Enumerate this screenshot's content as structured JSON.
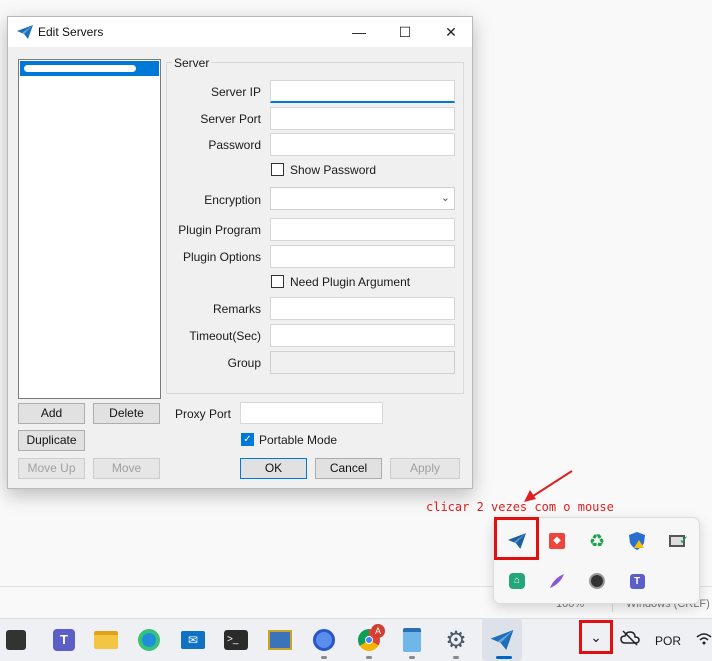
{
  "window": {
    "title": "Edit Servers",
    "minimize_glyph": "—",
    "maximize_glyph": "☐",
    "close_glyph": "✕"
  },
  "server_list": {
    "items": [
      {
        "label": "",
        "selected": true
      }
    ]
  },
  "server_group": {
    "title": "Server",
    "server_ip_label": "Server IP",
    "server_port_label": "Server Port",
    "password_label": "Password",
    "show_password_label": "Show Password",
    "encryption_label": "Encryption",
    "plugin_program_label": "Plugin Program",
    "plugin_options_label": "Plugin Options",
    "need_plugin_argument_label": "Need Plugin Argument",
    "remarks_label": "Remarks",
    "timeout_label": "Timeout(Sec)",
    "group_label": "Group",
    "show_password_checked": false,
    "need_plugin_argument_checked": false
  },
  "buttons": {
    "add": "Add",
    "delete": "Delete",
    "duplicate": "Duplicate",
    "move_up": "Move Up",
    "move": "Move",
    "ok": "OK",
    "cancel": "Cancel",
    "apply": "Apply"
  },
  "proxy": {
    "proxy_port_label": "Proxy Port",
    "portable_mode_label": "Portable Mode",
    "portable_mode_checked": true
  },
  "annotation": {
    "text": "clicar 2 vezes com o mouse",
    "color": "#e02020"
  },
  "background_status": {
    "zoom": "100%",
    "line_ending": "Windows (CRLF)"
  },
  "tray_popup": {
    "icons": [
      "shadowsocks-icon",
      "anydesk-icon",
      "recycle-icon",
      "defender-shield-icon",
      "network-check-icon",
      "green-app-icon",
      "feather-icon",
      "clock-icon",
      "teams-tray-icon"
    ]
  },
  "taskbar": {
    "language": "POR",
    "apps": [
      "start-icon",
      "teams-icon",
      "file-explorer-icon",
      "edge-icon",
      "mail-icon",
      "terminal-icon",
      "network-icon",
      "app-hub-icon",
      "chrome-icon",
      "notepad-icon",
      "settings-icon",
      "shadowsocks-taskbar-icon"
    ],
    "chrome_badge": "A"
  },
  "colors": {
    "accent": "#0078d7",
    "highlight": "#e01010"
  }
}
